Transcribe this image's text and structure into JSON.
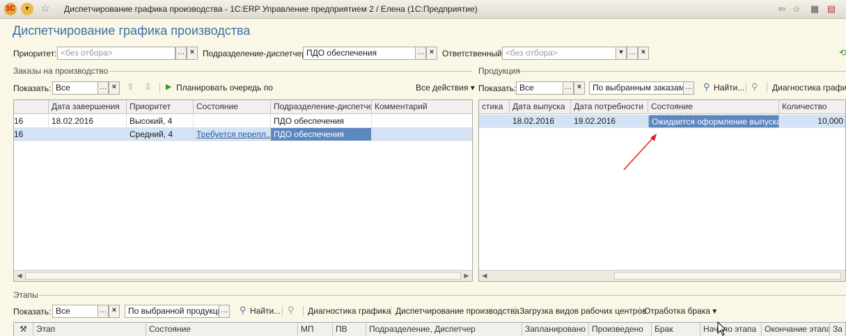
{
  "window": {
    "title": "Диспетчирование графика производства - 1С:ERP Управление предприятием 2 / Елена  (1С:Предприятие)"
  },
  "page": {
    "title": "Диспетчирование графика производства"
  },
  "filters": {
    "priority_label": "Приоритет:",
    "priority_value": "<без отбора>",
    "dept_label": "Подразделение-диспетчер:",
    "dept_value": "ПДО обеспечения",
    "responsible_label": "Ответственный:",
    "responsible_value": "<без отбора>"
  },
  "orders": {
    "section_title": "Заказы на производство",
    "show_label": "Показать:",
    "show_value": "Все",
    "plan_queue_label": "Планировать очередь по",
    "all_actions_label": "Все действия ▾",
    "columns": [
      "",
      "Дата завершения",
      "Приоритет",
      "Состояние",
      "Подразделение-диспетчер",
      "Комментарий"
    ],
    "rows": [
      [
        "16",
        "18.02.2016",
        "Высокий, 4",
        "",
        "ПДО обеспечения",
        ""
      ],
      [
        "16",
        "",
        "Средний, 4",
        "Требуется перепл...",
        "ПДО обеспечения",
        ""
      ]
    ]
  },
  "products": {
    "section_title": "Продукция",
    "show_label": "Показать:",
    "show_value": "Все",
    "scope_value": "По выбранным заказам",
    "find_label": "Найти...",
    "diag_label": "Диагностика графика",
    "columns": [
      "стика",
      "Дата выпуска",
      "Дата потребности",
      "Состояние",
      "Количество"
    ],
    "rows": [
      [
        "",
        "18.02.2016",
        "19.02.2016",
        "Ожидается оформление выпуска",
        "10,000"
      ]
    ]
  },
  "stages": {
    "section_title": "Этапы",
    "show_label": "Показать:",
    "show_value": "Все",
    "scope_value": "По выбранной продукции",
    "find_label": "Найти...",
    "diag_label": "Диагностика графика",
    "dispatch_label": "Диспетчирование производства",
    "load_label": "Загрузка видов рабочих центров",
    "defects_label": "Отработка брака ▾",
    "columns": [
      "Этап",
      "Состояние",
      "МП",
      "ПВ",
      "Подразделение, Диспетчер",
      "Запланировано",
      "Произведено",
      "Брак",
      "Начало этапа",
      "Окончание этапа",
      "За"
    ]
  },
  "colors": {
    "accent": "#3b6fa8",
    "selection": "#d3e3f5",
    "active_cell": "#5b86bf",
    "annotation_arrow": "#e02020"
  }
}
